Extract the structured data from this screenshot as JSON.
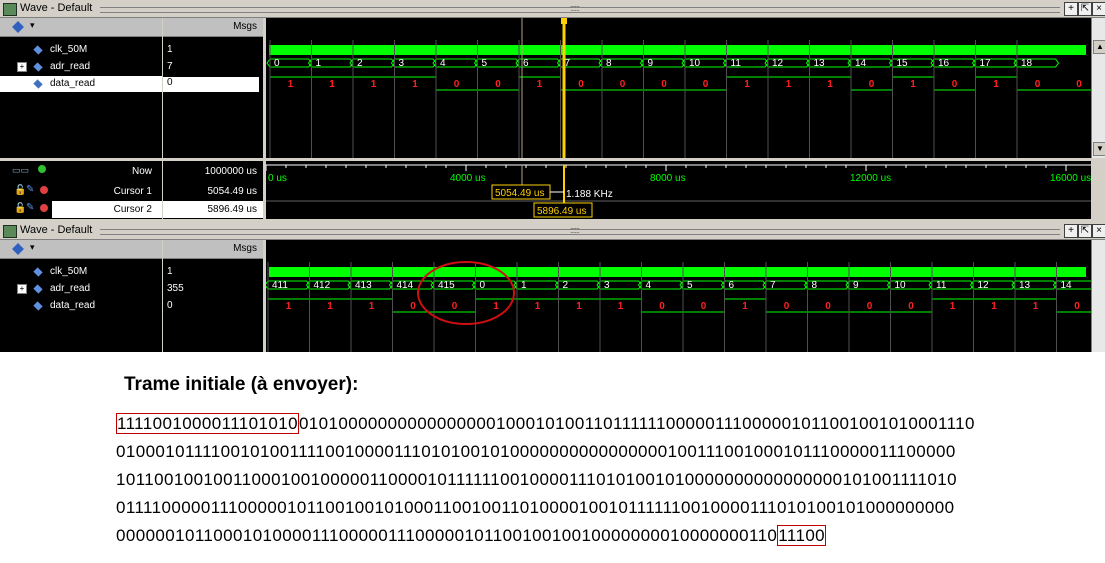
{
  "win1": {
    "title": "Wave - Default",
    "msgs_label": "Msgs",
    "signals": [
      {
        "name": "clk_50M",
        "value": "1"
      },
      {
        "name": "adr_read",
        "value": "7"
      },
      {
        "name": "data_read",
        "value": "0"
      }
    ],
    "adr_labels": [
      "0",
      "1",
      "2",
      "3",
      "4",
      "5",
      "6",
      "7",
      "8",
      "9",
      "10",
      "11",
      "12",
      "13",
      "14",
      "15",
      "16",
      "17",
      "18"
    ],
    "data_labels": [
      "1",
      "1",
      "1",
      "1",
      "0",
      "0",
      "1",
      "0",
      "0",
      "0",
      "0",
      "1",
      "1",
      "1",
      "0",
      "1",
      "0",
      "1",
      "0",
      "0"
    ],
    "now_label": "Now",
    "now_value": "1000000 us",
    "cursor1_label": "Cursor 1",
    "cursor1_value": "5054.49 us",
    "cursor2_label": "Cursor 2",
    "cursor2_value": "5896.49 us",
    "time_ticks": [
      "0 us",
      "4000 us",
      "8000 us",
      "12000 us",
      "16000 us"
    ],
    "cursor1_flag": "5054.49 us",
    "cursor2_flag": "5896.49 us",
    "freq_label": "1.188 KHz"
  },
  "win2": {
    "title": "Wave - Default",
    "msgs_label": "Msgs",
    "signals": [
      {
        "name": "clk_50M",
        "value": "1"
      },
      {
        "name": "adr_read",
        "value": "355"
      },
      {
        "name": "data_read",
        "value": "0"
      }
    ],
    "adr_labels": [
      "411",
      "412",
      "413",
      "414",
      "415",
      "0",
      "1",
      "2",
      "3",
      "4",
      "5",
      "6",
      "7",
      "8",
      "9",
      "10",
      "11",
      "12",
      "13",
      "14"
    ],
    "data_labels": [
      "1",
      "1",
      "1",
      "0",
      "0",
      "1",
      "1",
      "1",
      "1",
      "0",
      "0",
      "1",
      "0",
      "0",
      "0",
      "0",
      "1",
      "1",
      "1",
      "0"
    ]
  },
  "colors": {
    "wave_green": "#00ff00",
    "value_red": "#ff2020",
    "cursor_yellow": "#ffd000",
    "highlight_red": "#d01010"
  },
  "trame": {
    "title": "Trame initiale (à envoyer):",
    "line1_boxed": "1111001000011101010",
    "line1_rest": "0101000000000000000010001010011011111100000111000001011001001010001110",
    "line2": "010001011110010100111100100001110101001010000000000000000100111001000101110000011100000",
    "line3": "101100100100110001001000001100001011111100100001110101001010000000000000000101001111010",
    "line4": "011110000011100000101100100101000110010011010000100101111110010000111010100101000000000",
    "line5_rest": "00000010110001010000111000001110000010110010010010000000010000000110",
    "line5_boxed": "11100"
  }
}
